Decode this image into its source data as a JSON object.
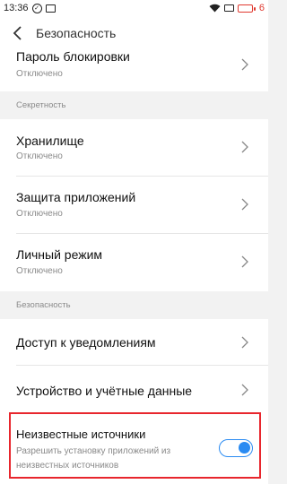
{
  "status_bar": {
    "time": "13:36",
    "battery": "6"
  },
  "header": {
    "title": "Безопасность"
  },
  "rows": [
    {
      "title": "Пароль блокировки",
      "subtitle": "Отключено"
    }
  ],
  "sections": {
    "privacy": {
      "label": "Секретность",
      "items": [
        {
          "title": "Хранилище",
          "subtitle": "Отключено"
        },
        {
          "title": "Защита приложений",
          "subtitle": "Отключено"
        },
        {
          "title": "Личный режим",
          "subtitle": "Отключено"
        }
      ]
    },
    "security": {
      "label": "Безопасность",
      "items": [
        {
          "title": "Доступ к уведомлениям"
        },
        {
          "title": "Устройство и учётные данные"
        }
      ]
    }
  },
  "unknown_sources": {
    "title": "Неизвестные источники",
    "subtitle_line1": "Разрешить установку приложений из",
    "subtitle_line2": "неизвестных источников",
    "enabled": true
  },
  "colors": {
    "accent": "#2a8bf2",
    "highlight": "#e8262d",
    "battery": "#e0392f"
  }
}
